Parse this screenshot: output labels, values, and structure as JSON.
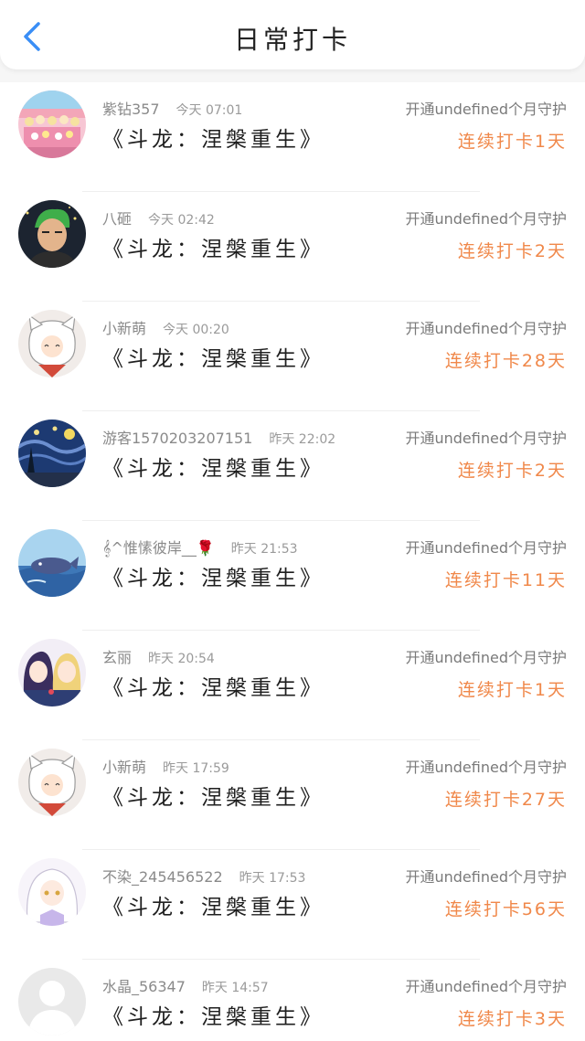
{
  "header": {
    "title": "日常打卡",
    "back_icon": "chevron-left-icon",
    "accent": "#3a8ef6"
  },
  "colors": {
    "streak": "#f0884a",
    "meta": "#8a8a8a"
  },
  "entries": [
    {
      "user": "紫钻357",
      "time": "今天 07:01",
      "book": "《斗龙：涅槃重生》",
      "guard": "开通undefined个月守护",
      "streak": "连续打卡1天",
      "avatar": "crowd"
    },
    {
      "user": "八砸",
      "time": "今天 02:42",
      "book": "《斗龙：涅槃重生》",
      "guard": "开通undefined个月守护",
      "streak": "连续打卡2天",
      "avatar": "green-hair"
    },
    {
      "user": "小新萌",
      "time": "今天 00:20",
      "book": "《斗龙：涅槃重生》",
      "guard": "开通undefined个月守护",
      "streak": "连续打卡28天",
      "avatar": "white-dog"
    },
    {
      "user": "游客1570203207151",
      "time": "昨天 22:02",
      "book": "《斗龙：涅槃重生》",
      "guard": "开通undefined个月守护",
      "streak": "连续打卡2天",
      "avatar": "starry-night"
    },
    {
      "user": "𝄞^惟愫彼岸__🌹",
      "time": "昨天 21:53",
      "book": "《斗龙：涅槃重生》",
      "guard": "开通undefined个月守护",
      "streak": "连续打卡11天",
      "avatar": "whale"
    },
    {
      "user": "玄丽",
      "time": "昨天 20:54",
      "book": "《斗龙：涅槃重生》",
      "guard": "开通undefined个月守护",
      "streak": "连续打卡1天",
      "avatar": "anime-pair"
    },
    {
      "user": "小新萌",
      "time": "昨天 17:59",
      "book": "《斗龙：涅槃重生》",
      "guard": "开通undefined个月守护",
      "streak": "连续打卡27天",
      "avatar": "white-dog"
    },
    {
      "user": "不染_245456522",
      "time": "昨天 17:53",
      "book": "《斗龙：涅槃重生》",
      "guard": "开通undefined个月守护",
      "streak": "连续打卡56天",
      "avatar": "white-hair-girl"
    },
    {
      "user": "水晶_56347",
      "time": "昨天 14:57",
      "book": "《斗龙：涅槃重生》",
      "guard": "开通undefined个月守护",
      "streak": "连续打卡3天",
      "avatar": "default-user"
    }
  ]
}
